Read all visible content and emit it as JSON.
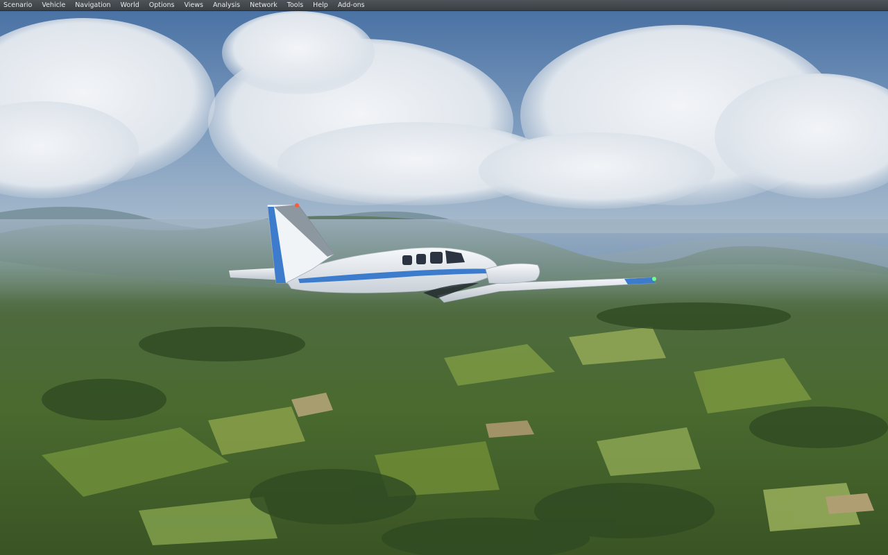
{
  "menu": {
    "items": [
      {
        "label": "Scenario"
      },
      {
        "label": "Vehicle"
      },
      {
        "label": "Navigation"
      },
      {
        "label": "World"
      },
      {
        "label": "Options"
      },
      {
        "label": "Views"
      },
      {
        "label": "Analysis"
      },
      {
        "label": "Network"
      },
      {
        "label": "Tools"
      },
      {
        "label": "Help"
      },
      {
        "label": "Add-ons"
      }
    ]
  },
  "scene": {
    "colors": {
      "sky_top": "#4f77a8",
      "sky_horizon": "#a9bdd0",
      "cloud": "#e9edf2",
      "terrain_near": "#3c5a27",
      "terrain_far": "#6f8a74",
      "aircraft_body": "#eef1f4",
      "aircraft_stripe": "#3f7fd0"
    }
  }
}
